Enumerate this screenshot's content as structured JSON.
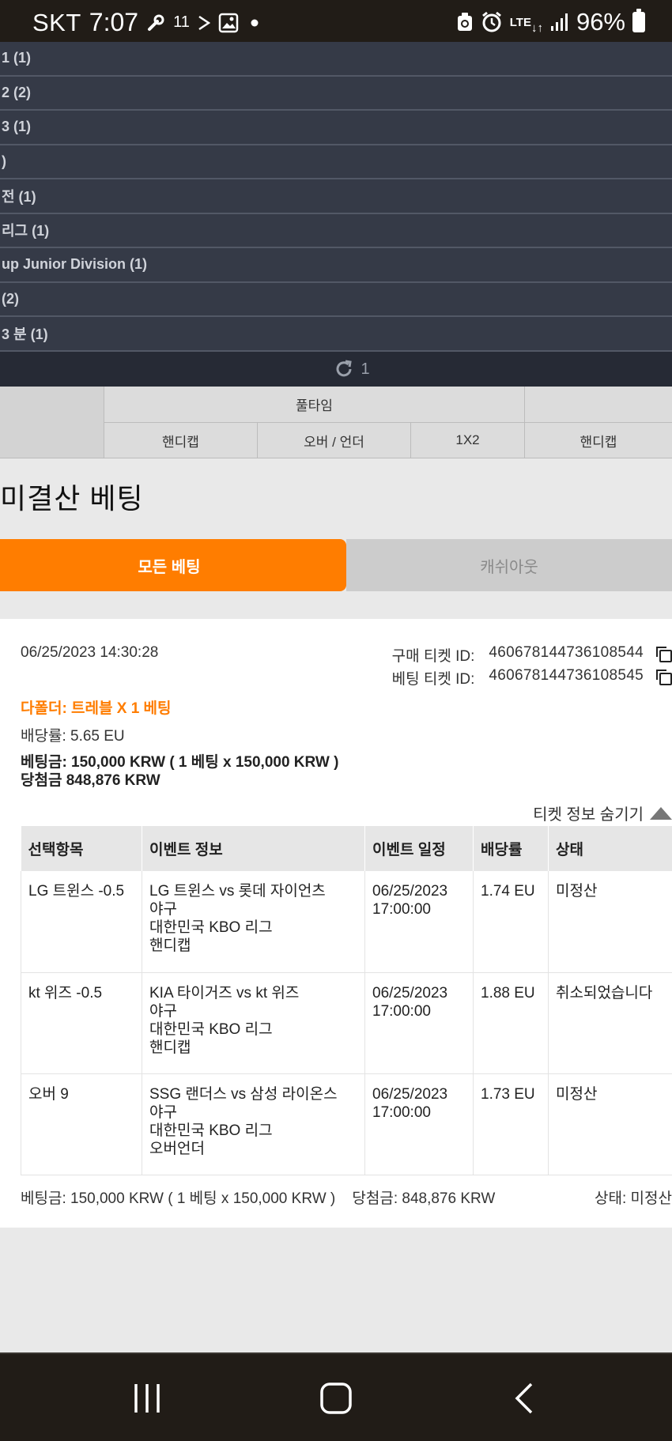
{
  "status_bar": {
    "carrier": "SKT",
    "time": "7:07",
    "mini_label": "11",
    "network": "LTE",
    "battery": "96%"
  },
  "league_list": [
    "1 (1)",
    "2 (2)",
    "3 (1)",
    ")",
    "전 (1)",
    "리그 (1)",
    "up Junior Division (1)",
    "(2)",
    "3 분 (1)"
  ],
  "refresh": {
    "count": "1"
  },
  "odds_header": {
    "group": "풀타임",
    "columns": [
      "핸디캡",
      "오버 / 언더",
      "1X2",
      "핸디캡"
    ]
  },
  "unsettled": {
    "title": "미결산 베팅",
    "tabs": {
      "all": "모든 베팅",
      "cashout": "캐쉬아웃"
    }
  },
  "bet": {
    "datetime": "06/25/2023 14:30:28",
    "purchase_ticket_label": "구매 티켓 ID:",
    "purchase_ticket_id": "460678144736108544",
    "bet_ticket_label": "베팅 티켓 ID:",
    "bet_ticket_id": "460678144736108545",
    "bet_type": "다폴더: 트레블 X 1 베팅",
    "odds": "배당률: 5.65 EU",
    "stake": "베팅금: 150,000 KRW ( 1 베팅 x 150,000 KRW )",
    "winnings": "당첨금 848,876 KRW",
    "hide_info": "티켓 정보 숨기기",
    "table_headers": [
      "선택항목",
      "이벤트 정보",
      "이벤트 일정",
      "배당률",
      "상태"
    ],
    "selections": [
      {
        "pick": "LG 트윈스 -0.5",
        "event": "LG 트윈스 vs 롯데 자이언츠",
        "sport": "야구",
        "league": "대한민국 KBO 리그",
        "market": "핸디캡",
        "date": "06/25/2023",
        "time": "17:00:00",
        "odds": "1.74 EU",
        "status": "미정산"
      },
      {
        "pick": "kt 위즈 -0.5",
        "event": "KIA 타이거즈 vs kt 위즈",
        "sport": "야구",
        "league": "대한민국 KBO 리그",
        "market": "핸디캡",
        "date": "06/25/2023",
        "time": "17:00:00",
        "odds": "1.88 EU",
        "status": "취소되었습니다"
      },
      {
        "pick": "오버 9",
        "event": "SSG 랜더스 vs 삼성 라이온스",
        "sport": "야구",
        "league": "대한민국 KBO 리그",
        "market": "오버언더",
        "date": "06/25/2023",
        "time": "17:00:00",
        "odds": "1.73 EU",
        "status": "미정산"
      }
    ],
    "footer_stake": "베팅금: 150,000 KRW ( 1 베팅 x 150,000 KRW )",
    "footer_winnings": "당첨금: 848,876 KRW",
    "footer_status": "상태: 미정산"
  }
}
